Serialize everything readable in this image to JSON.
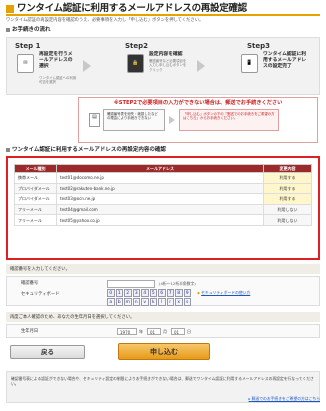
{
  "header": {
    "title": "ワンタイム認証に利用するメールアドレスの再設定確認",
    "intro": "ワンタイム認証の再設定内容を確認のうえ、必要事項を入力し「申し込む」ボタンを押してください。"
  },
  "flow": {
    "title": "お手続きの流れ",
    "steps": [
      {
        "name": "Step 1",
        "text": "再設定を行うメールアドレスの選択",
        "sub": "ワンタイム認証への利用可否を選択"
      },
      {
        "name": "Step2",
        "text": "設定内容を確認",
        "sub": "確認番号など必要項目を入力し申し込むボタンをクリック"
      },
      {
        "name": "Step3",
        "text": "ワンタイム認証に利用するメールアドレスの設定完了",
        "sub": ""
      }
    ]
  },
  "notice": {
    "head": "※STEP2で必要項目の入力ができない場合は、郵送でお手続きください",
    "left": "確認番号表を紛失・破損したなどの理由により手続きできない",
    "right": "「申し込む」ボタンの下の「郵送でのお手続きをご希望の方はこちら」からお手続きください。"
  },
  "mail_section": {
    "title": "ワンタイム認証に利用するメールアドレスの再設定内容の確認",
    "columns": [
      "メール種別",
      "メールアドレス",
      "変更内容"
    ],
    "rows": [
      {
        "type": "携帯メール",
        "address": "test01@docomo.ne.jp",
        "status": "利用する"
      },
      {
        "type": "プロバイダメール",
        "address": "test02@rakuten-bank.ne.jp",
        "status": "利用する"
      },
      {
        "type": "プロバイダメール",
        "address": "test03@ocn.ne.jp",
        "status": "利用する"
      },
      {
        "type": "フリーメール",
        "address": "test04@gmail.com",
        "status": "利用しない"
      },
      {
        "type": "フリーメール",
        "address": "test05@yahoo.co.jp",
        "status": "利用しない"
      }
    ]
  },
  "confirm": {
    "band": "確認番号を入力してください。",
    "code_label": "確認番号",
    "code_hint": "(4桁〜12桁半角数字)",
    "keyboard_label": "セキュリティボード",
    "digits": [
      "0",
      "1",
      "2",
      "3",
      "4",
      "5",
      "6",
      "7",
      "8",
      "9"
    ],
    "letters": [
      "a",
      "b",
      "m",
      "n",
      "v",
      "k",
      "l",
      "r",
      "x",
      "s"
    ],
    "keyboard_link": "セキュリティボードの使い方"
  },
  "birthday": {
    "band": "再度ご本人確認のため、あなたの生年月日を選択してください。",
    "label": "生年月日",
    "year": "1970",
    "year_unit": "年",
    "month": "01",
    "month_unit": "月",
    "day": "01",
    "day_unit": "日"
  },
  "buttons": {
    "back": "戻る",
    "submit": "申し込む"
  },
  "footer": {
    "text": "確認番号表による認証ができない場合や、セキュリティ設定の制限によりお手続きができない場合は、郵送でワンタイム認証に利用するメールアドレスの再設定を行なってください。",
    "link": "郵送でのお手続きをご希望の方はこちら"
  }
}
